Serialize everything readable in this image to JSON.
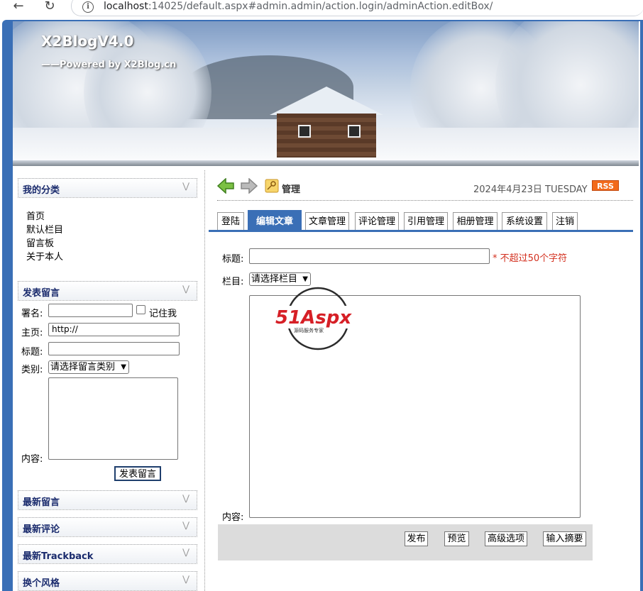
{
  "browser": {
    "url_host": "localhost",
    "url_rest": ":14025/default.aspx#admin.admin/action.login/adminAction.editBox/"
  },
  "header": {
    "title": "X2BlogV4.0",
    "subtitle": "——Powered by X2Blog.cn"
  },
  "sidebar": {
    "categories_title": "我的分类",
    "categories": [
      "首页",
      "默认栏目",
      "留言板",
      "关于本人"
    ],
    "guestbook_title": "发表留言",
    "guestbook": {
      "name_label": "署名:",
      "remember_label": "记住我",
      "home_label": "主页:",
      "home_value": "http://",
      "subject_label": "标题:",
      "type_label": "类别:",
      "type_select": "请选择留言类别",
      "content_label": "内容:",
      "submit": "发表留言"
    },
    "latest_messages": "最新留言",
    "latest_comments": "最新评论",
    "latest_trackback": "最新Trackback",
    "change_style": "换个风格"
  },
  "toolbar": {
    "manage_label": "管理",
    "date": "2024年4月23日  TUESDAY",
    "rss": "RSS"
  },
  "tabs": [
    "登陆",
    "编辑文章",
    "文章管理",
    "评论管理",
    "引用管理",
    "相册管理",
    "系统设置",
    "注销"
  ],
  "editor": {
    "title_label": "标题:",
    "title_hint": "* 不超过50个字符",
    "column_label": "栏目:",
    "column_select": "请选择栏目",
    "content_label": "内容:",
    "buttons": {
      "publish": "发布",
      "preview": "预览",
      "advanced": "高级选项",
      "summary": "输入摘要"
    }
  },
  "watermark": {
    "brand": "51Aspx",
    "tagline": "源码服务专家"
  },
  "colors": {
    "frame": "#3a6fb6",
    "accent_text": "#1a2b6d",
    "hint": "#d32f1e",
    "rss": "#f26a1b"
  }
}
